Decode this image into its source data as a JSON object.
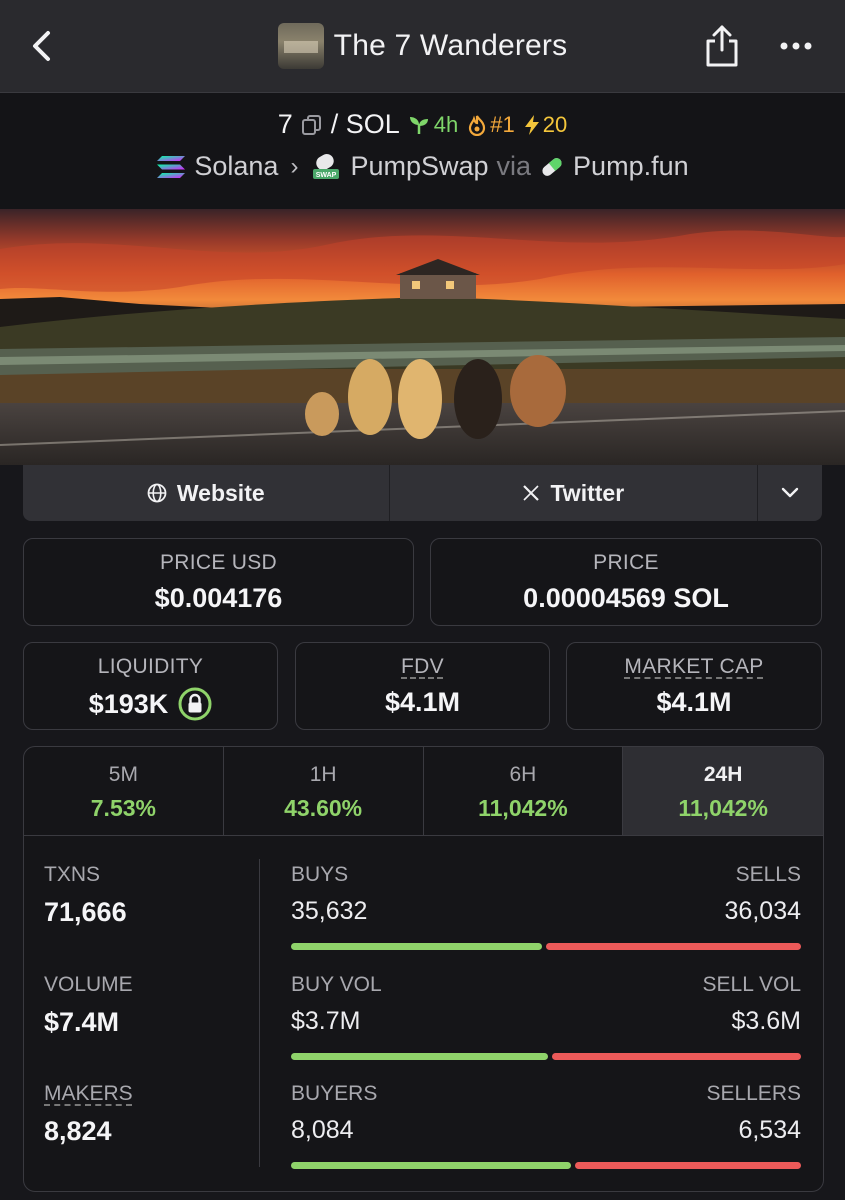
{
  "nav": {
    "title": "The 7 Wanderers",
    "back_icon": "chevron-left-icon",
    "share_icon": "share-icon",
    "more_icon": "more-icon"
  },
  "pair": {
    "base": "7",
    "quote": "/ SOL",
    "age": "4h",
    "rank": "#1",
    "boosts": "20",
    "chain": "Solana",
    "dex": "PumpSwap",
    "via": "via",
    "launchpad": "Pump.fun"
  },
  "links": {
    "website": "Website",
    "twitter": "Twitter"
  },
  "prices": {
    "price_usd_label": "PRICE USD",
    "price_usd": "$0.004176",
    "price_label": "PRICE",
    "price": "0.00004569 SOL"
  },
  "metrics": {
    "liquidity_label": "LIQUIDITY",
    "liquidity": "$193K",
    "fdv_label": "FDV",
    "fdv": "$4.1M",
    "mcap_label": "MARKET CAP",
    "mcap": "$4.1M"
  },
  "tabs": [
    {
      "label": "5M",
      "change": "7.53%"
    },
    {
      "label": "1H",
      "change": "43.60%"
    },
    {
      "label": "6H",
      "change": "11,042%"
    },
    {
      "label": "24H",
      "change": "11,042%"
    }
  ],
  "active_tab": "24H",
  "stats": {
    "txns_label": "TXNS",
    "txns": "71,666",
    "volume_label": "VOLUME",
    "volume": "$7.4M",
    "makers_label": "MAKERS",
    "makers": "8,824",
    "buys_label": "BUYS",
    "buys": "35,632",
    "sells_label": "SELLS",
    "sells": "36,034",
    "buy_vol_label": "BUY VOL",
    "buy_vol": "$3.7M",
    "sell_vol_label": "SELL VOL",
    "sell_vol": "$3.6M",
    "buyers_label": "BUYERS",
    "buyers": "8,084",
    "sellers_label": "SELLERS",
    "sellers": "6,534",
    "buys_share": 0.497,
    "buy_vol_share": 0.507,
    "buyers_share": 0.553
  },
  "colors": {
    "positive": "#8fd36a",
    "negative": "#ec5a59",
    "background": "#17171b"
  }
}
